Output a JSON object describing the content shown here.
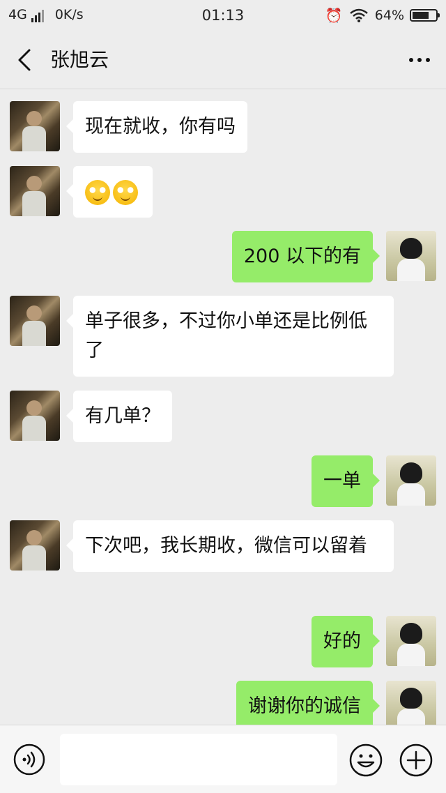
{
  "status_bar": {
    "network": "4G",
    "speed": "0K/s",
    "time": "01:13",
    "battery": "64%",
    "battery_level": 0.64
  },
  "header": {
    "title": "张旭云"
  },
  "messages": [
    {
      "side": "in",
      "text": "现在就收，你有吗"
    },
    {
      "side": "in",
      "emoji": [
        "smirk-emoji",
        "smirk-emoji"
      ]
    },
    {
      "side": "out",
      "text": "200 以下的有"
    },
    {
      "side": "in",
      "text": "单子很多，不过你小单还是比例低了"
    },
    {
      "side": "in",
      "text": "有几单？"
    },
    {
      "side": "out",
      "text": "一单"
    },
    {
      "side": "in",
      "text": "下次吧，我长期收，微信可以留着"
    },
    {
      "side": "out",
      "text": "好的"
    },
    {
      "side": "out",
      "text": "谢谢你的诚信"
    }
  ],
  "input": {
    "value": ""
  },
  "colors": {
    "background": "#ededed",
    "incoming_bubble": "#ffffff",
    "outgoing_bubble": "#95ec69"
  }
}
